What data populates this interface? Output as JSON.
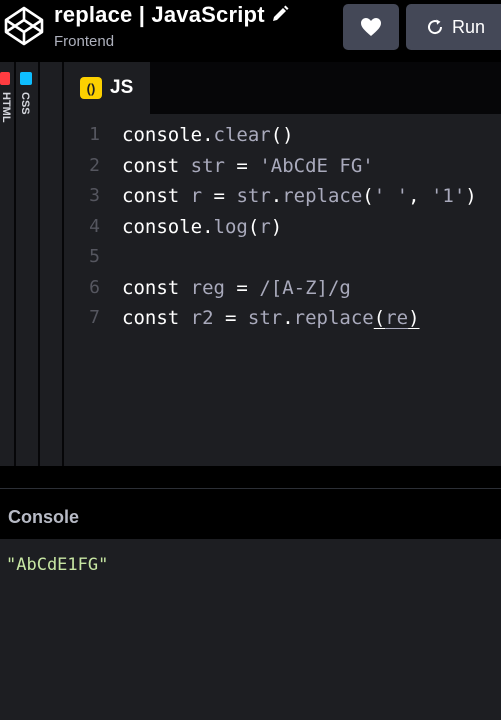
{
  "header": {
    "title": "replace | JavaScript",
    "subtitle": "Frontend",
    "run_label": "Run"
  },
  "editors": {
    "html_label": "HTML",
    "css_label": "CSS",
    "js_label": "JS",
    "js_badge": "()"
  },
  "code": {
    "line_numbers": [
      "1",
      "2",
      "3",
      "4",
      "5",
      "6",
      "7"
    ],
    "lines": [
      [
        "console",
        ".",
        "clear",
        "()"
      ],
      [
        "const",
        " ",
        "str",
        " = ",
        "'AbCdE FG'"
      ],
      [
        "const",
        " ",
        "r",
        " = ",
        "str",
        ".",
        "replace",
        "(",
        "' '",
        ", ",
        "'1'",
        ")"
      ],
      [
        "console",
        ".",
        "log",
        "(",
        "r",
        ")"
      ],
      [],
      [
        "const",
        " ",
        "reg",
        " = ",
        "/[A-Z]/g"
      ],
      [
        "const",
        " ",
        "r2",
        " = ",
        "str",
        ".",
        "replace",
        "(",
        "re",
        ")"
      ]
    ]
  },
  "console": {
    "title": "Console",
    "output": "\"AbCdE1FG\""
  },
  "colors": {
    "html_badge": "#ff3c41",
    "css_badge": "#0ebeff",
    "js_badge": "#fcd000",
    "console_text": "#c7e6a3"
  }
}
